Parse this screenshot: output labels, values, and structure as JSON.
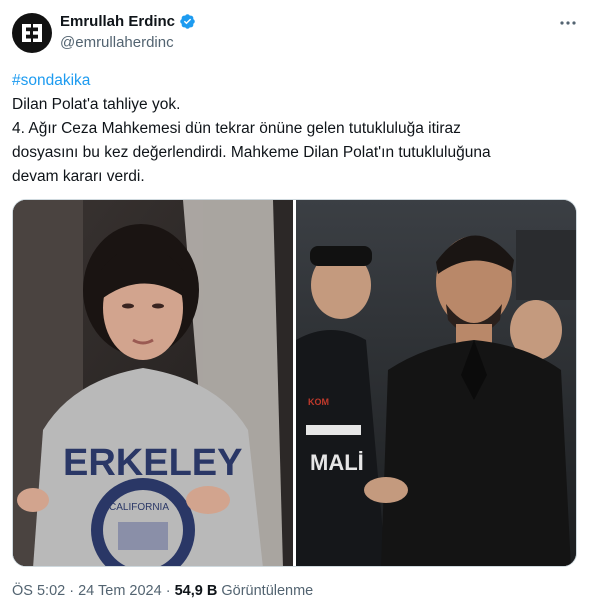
{
  "author": {
    "display_name": "Emrullah Erdinc",
    "handle": "@emrullaherdinc",
    "avatar_icon": "letter-e-logo-icon",
    "verified_icon": "verified-badge-icon",
    "verified_color": "#1d9bf0"
  },
  "more_icon": "more-options-icon",
  "tweet": {
    "hashtag": "#sondakika",
    "line1": "Dilan Polat'a tahliye yok.",
    "line2": "4. Ağır Ceza Mahkemesi dün tekrar önüne gelen tutukluluğa itiraz",
    "line3": "dosyasını bu kez değerlendirdi.  Mahkeme Dilan Polat'ın tutukluluğuna",
    "line4": "devam kararı verdi."
  },
  "media": {
    "left_sweatshirt_text": "ERKELEY",
    "left_seal_text": "CALIFORNIA",
    "right_vest_text_1": "MALİ",
    "right_vest_text_2": "KOM"
  },
  "meta": {
    "time": "ÖS 5:02",
    "separator": "·",
    "date": "24 Tem 2024",
    "views_count": "54,9 B",
    "views_label": "Görüntülenme"
  },
  "colors": {
    "accent": "#1d9bf0",
    "text": "#0f1419",
    "secondary": "#536471"
  }
}
